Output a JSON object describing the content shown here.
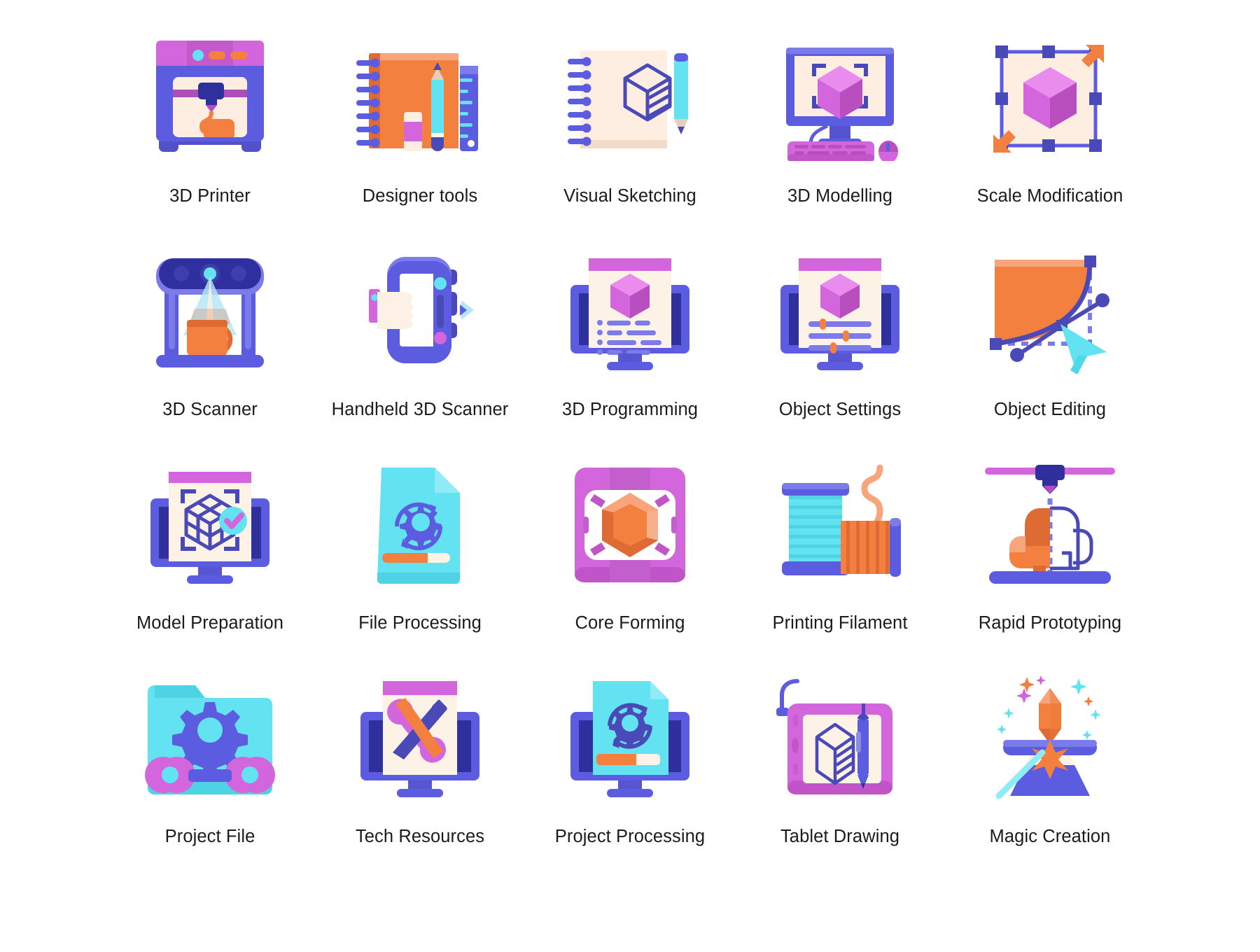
{
  "palette": {
    "indigo": "#5c5ce0",
    "indigo_light": "#7b7bea",
    "indigo_dark": "#4a49b8",
    "navy": "#2f2f9e",
    "navy_deep": "#343499",
    "orange": "#f4803f",
    "orange_dark": "#dd6b33",
    "orange_light": "#f9a57c",
    "cream": "#fdeee1",
    "cream_light": "#fdf5ec",
    "magenta": "#d466dd",
    "magenta_light": "#e88ce8",
    "magenta_deep": "#c559c8",
    "cyan": "#63e3f2",
    "cyan_light": "#8fecf7",
    "white": "#ffffff",
    "text": "#1b1b1f"
  },
  "grid": {
    "columns": 5,
    "rows": 4,
    "total_icons": 20
  },
  "icons": [
    {
      "id": "printer-3d",
      "label": "3D Printer",
      "row": 1,
      "col": 1
    },
    {
      "id": "designer-tools",
      "label": "Designer tools",
      "row": 1,
      "col": 2
    },
    {
      "id": "visual-sketching",
      "label": "Visual Sketching",
      "row": 1,
      "col": 3
    },
    {
      "id": "modelling-3d",
      "label": "3D Modelling",
      "row": 1,
      "col": 4
    },
    {
      "id": "scale-modification",
      "label": "Scale Modification",
      "row": 1,
      "col": 5
    },
    {
      "id": "scanner-3d",
      "label": "3D Scanner",
      "row": 2,
      "col": 1
    },
    {
      "id": "handheld-3d-scanner",
      "label": "Handheld 3D Scanner",
      "row": 2,
      "col": 2
    },
    {
      "id": "programming-3d",
      "label": "3D Programming",
      "row": 2,
      "col": 3
    },
    {
      "id": "object-settings",
      "label": "Object Settings",
      "row": 2,
      "col": 4
    },
    {
      "id": "object-editing",
      "label": "Object Editing",
      "row": 2,
      "col": 5
    },
    {
      "id": "model-preparation",
      "label": "Model Preparation",
      "row": 3,
      "col": 1
    },
    {
      "id": "file-processing",
      "label": "File Processing",
      "row": 3,
      "col": 2
    },
    {
      "id": "core-forming",
      "label": "Core Forming",
      "row": 3,
      "col": 3
    },
    {
      "id": "printing-filament",
      "label": "Printing Filament",
      "row": 3,
      "col": 4
    },
    {
      "id": "rapid-prototyping",
      "label": "Rapid Prototyping",
      "row": 3,
      "col": 5
    },
    {
      "id": "project-file",
      "label": "Project File",
      "row": 4,
      "col": 1
    },
    {
      "id": "tech-resources",
      "label": "Tech Resources",
      "row": 4,
      "col": 2
    },
    {
      "id": "project-processing",
      "label": "Project Processing",
      "row": 4,
      "col": 3
    },
    {
      "id": "tablet-drawing",
      "label": "Tablet Drawing",
      "row": 4,
      "col": 4
    },
    {
      "id": "magic-creation",
      "label": "Magic Creation",
      "row": 4,
      "col": 5
    }
  ]
}
